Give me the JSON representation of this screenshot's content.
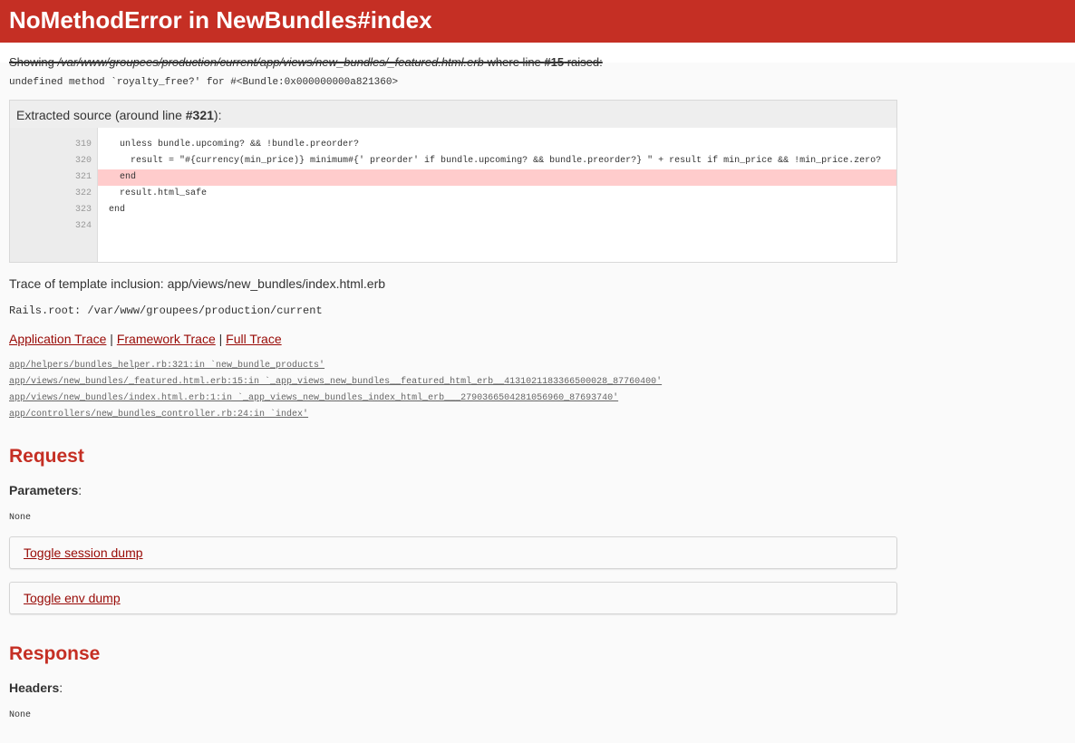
{
  "header": {
    "title": "NoMethodError in NewBundles#index"
  },
  "showing": {
    "prefix": "Showing ",
    "path": "/var/www/groupees/production/current/app/views/new_bundles/_featured.html.erb",
    "suffix": " where line ",
    "line": "#15",
    "end": " raised:"
  },
  "error_message": "undefined method `royalty_free?' for #<Bundle:0x000000000a821360>",
  "source": {
    "title_prefix": "Extracted source (around line ",
    "title_line": "#321",
    "title_suffix": "):",
    "lines": [
      {
        "num": "319",
        "code": "    unless bundle.upcoming? && !bundle.preorder?",
        "highlight": false
      },
      {
        "num": "320",
        "code": "      result = \"#{currency(min_price)} minimum#{' preorder' if bundle.upcoming? && bundle.preorder?} \" + result if min_price && !min_price.zero?",
        "highlight": false
      },
      {
        "num": "321",
        "code": "    end",
        "highlight": true
      },
      {
        "num": "322",
        "code": "    result.html_safe",
        "highlight": false
      },
      {
        "num": "323",
        "code": "  end",
        "highlight": false
      },
      {
        "num": "324",
        "code": "",
        "highlight": false
      }
    ]
  },
  "template_trace": "Trace of template inclusion: app/views/new_bundles/index.html.erb",
  "rails_root": "Rails.root: /var/www/groupees/production/current",
  "trace_links": {
    "application": "Application Trace",
    "sep1": " | ",
    "framework": "Framework Trace",
    "sep2": " | ",
    "full": "Full Trace"
  },
  "trace_entries": [
    "app/helpers/bundles_helper.rb:321:in `new_bundle_products'",
    "app/views/new_bundles/_featured.html.erb:15:in `_app_views_new_bundles__featured_html_erb__4131021183366500028_87760400'",
    "app/views/new_bundles/index.html.erb:1:in `_app_views_new_bundles_index_html_erb___2790366504281056960_87693740'",
    "app/controllers/new_bundles_controller.rb:24:in `index'"
  ],
  "request": {
    "heading": "Request",
    "params_label": "Parameters",
    "params_value": "None",
    "toggle_session": "Toggle session dump",
    "toggle_env": "Toggle env dump"
  },
  "response": {
    "heading": "Response",
    "headers_label": "Headers",
    "headers_value": "None"
  },
  "colors": {
    "accent": "#c52f24",
    "link": "#980905",
    "highlight": "#ffcccc"
  }
}
